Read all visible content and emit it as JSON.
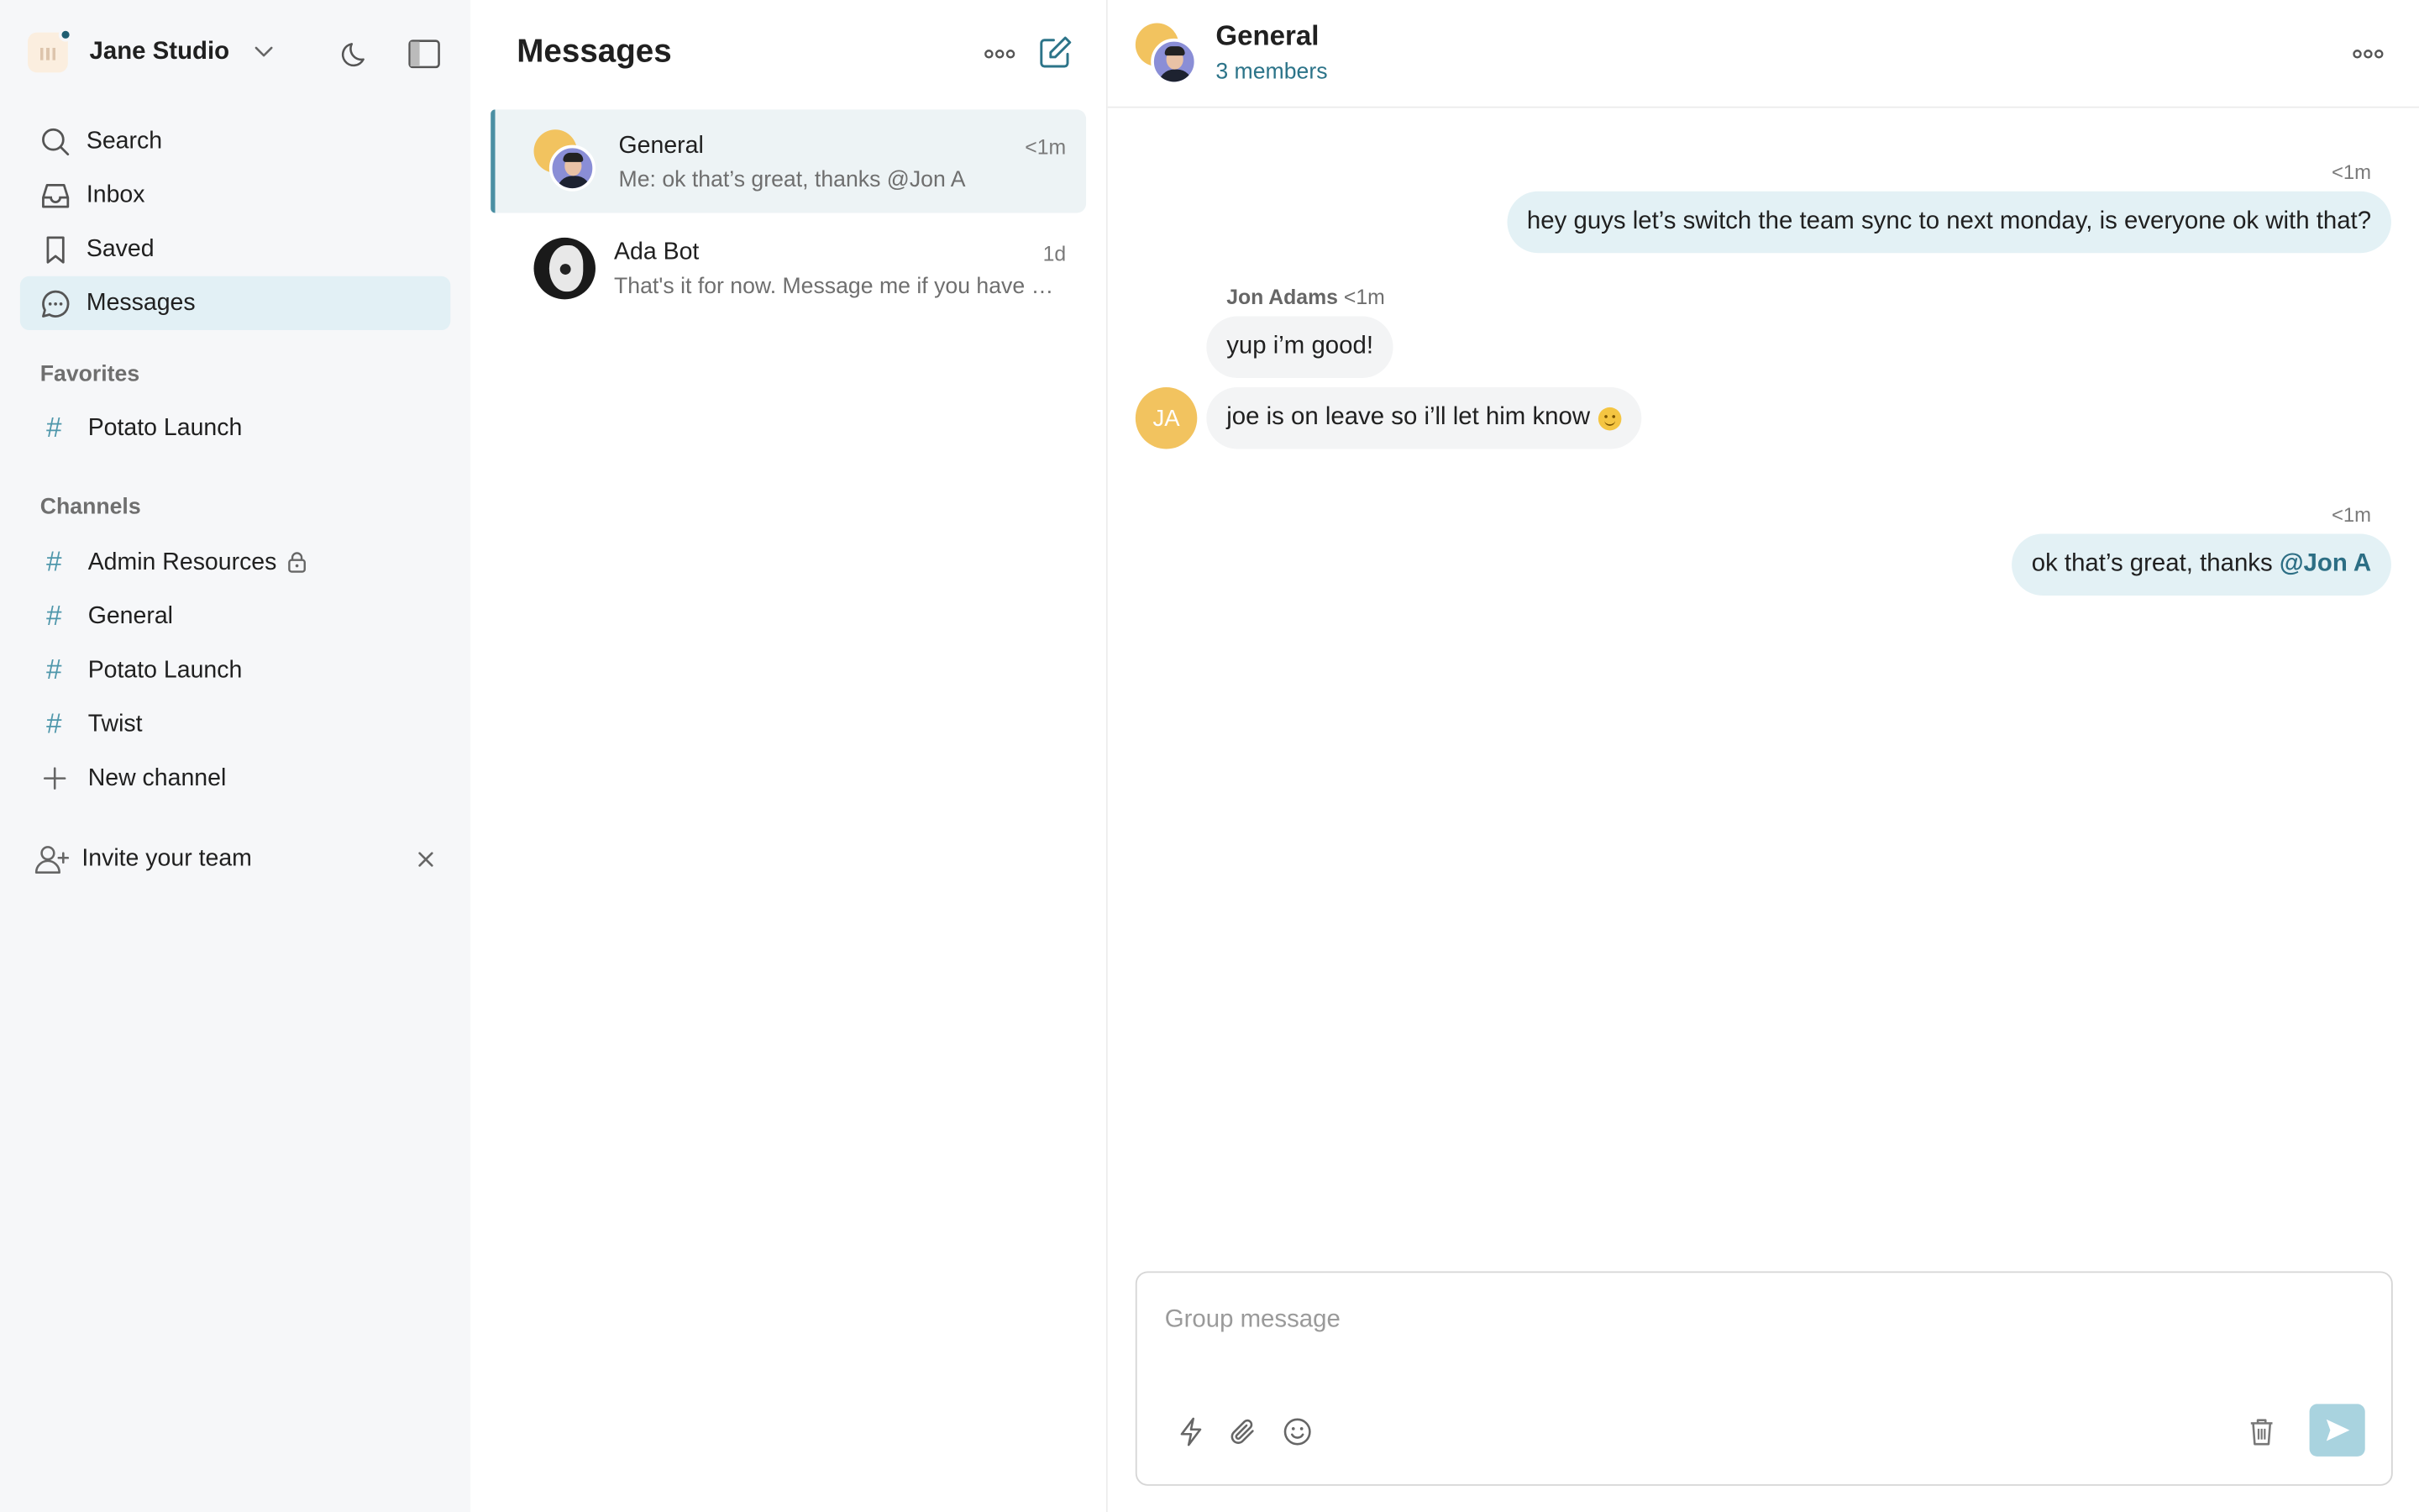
{
  "workspace": {
    "name": "Jane Studio"
  },
  "nav": [
    {
      "label": "Search",
      "icon": "search-icon"
    },
    {
      "label": "Inbox",
      "icon": "inbox-icon"
    },
    {
      "label": "Saved",
      "icon": "bookmark-icon"
    },
    {
      "label": "Messages",
      "icon": "chat-icon",
      "active": true
    }
  ],
  "favorites": {
    "title": "Favorites",
    "items": [
      {
        "label": "Potato Launch"
      }
    ]
  },
  "channels": {
    "title": "Channels",
    "items": [
      {
        "label": "Admin Resources",
        "locked": true
      },
      {
        "label": "General"
      },
      {
        "label": "Potato Launch"
      },
      {
        "label": "Twist"
      }
    ],
    "new_label": "New channel"
  },
  "invite": {
    "label": "Invite your team"
  },
  "list": {
    "title": "Messages",
    "conversations": [
      {
        "name": "General",
        "time": "<1m",
        "preview": "Me: ok that’s great, thanks @Jon A",
        "active": true
      },
      {
        "name": "Ada Bot",
        "time": "1d",
        "preview": "That's it for now. Message me if you have any questions."
      }
    ]
  },
  "chat": {
    "title": "General",
    "subtitle": "3 members",
    "messages": [
      {
        "time": "<1m",
        "text": "hey guys let’s switch the team sync to next monday, is everyone ok with that?"
      },
      {
        "sender": "Jon Adams",
        "time": "<1m",
        "text": "yup i’m good!"
      },
      {
        "avatar": "JA",
        "text": "joe is on leave so i’ll let him know"
      },
      {
        "time": "<1m",
        "text": "ok that’s great, thanks ",
        "mention": "@Jon A"
      }
    ],
    "composer": {
      "placeholder": "Group message"
    }
  },
  "colors": {
    "accent": "#4f97ab",
    "active_nav": "#e2f0f5",
    "my_bubble": "#e3f1f5",
    "avatar_yellow": "#f2c35f",
    "send_button": "#a9d3df"
  }
}
